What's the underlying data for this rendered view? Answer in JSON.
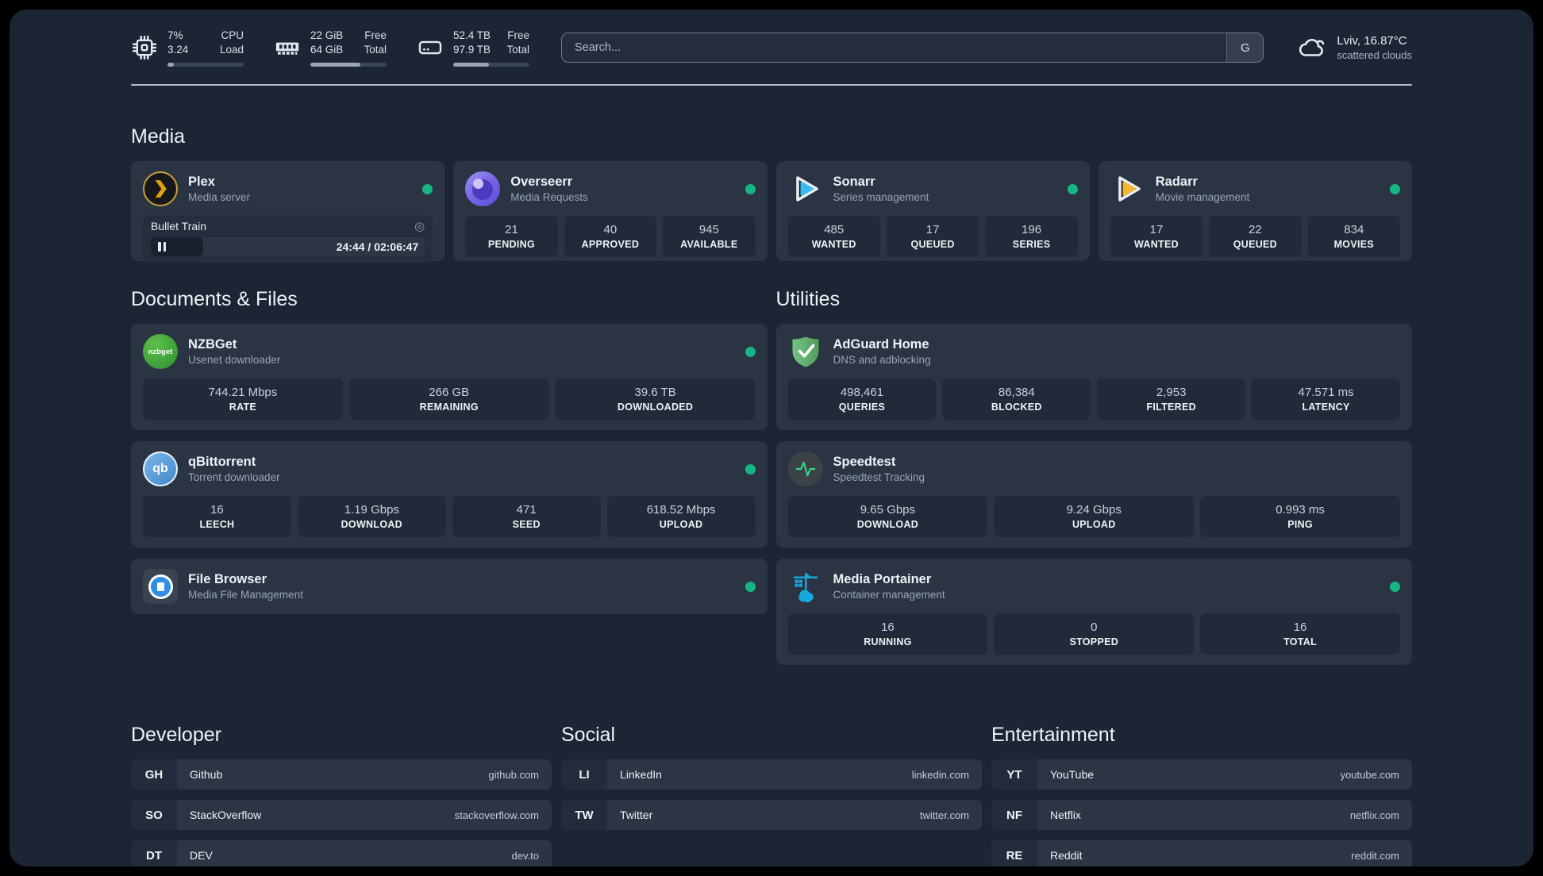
{
  "header": {
    "stats": [
      {
        "icon": "cpu-icon",
        "values": [
          "7%",
          "3.24"
        ],
        "labels": [
          "CPU",
          "Load"
        ],
        "progress_pct": 8
      },
      {
        "icon": "memory-icon",
        "values": [
          "22 GiB",
          "64 GiB"
        ],
        "labels": [
          "Free",
          "Total"
        ],
        "progress_pct": 66
      },
      {
        "icon": "disk-icon",
        "values": [
          "52.4 TB",
          "97.9 TB"
        ],
        "labels": [
          "Free",
          "Total"
        ],
        "progress_pct": 47
      }
    ],
    "search": {
      "placeholder": "Search...",
      "engine_label": "G"
    },
    "weather": {
      "icon": "cloud-icon",
      "title": "Lviv, 16.87°C",
      "subtitle": "scattered clouds"
    }
  },
  "media": {
    "heading": "Media",
    "plex": {
      "name": "Plex",
      "desc": "Media server",
      "status": "online",
      "now_playing": {
        "title": "Bullet Train",
        "time": "24:44 / 02:06:47",
        "progress_pct": 19,
        "cast_glyph": "◎"
      }
    },
    "overseerr": {
      "name": "Overseerr",
      "desc": "Media Requests",
      "status": "online",
      "stats": [
        {
          "value": "21",
          "label": "PENDING"
        },
        {
          "value": "40",
          "label": "APPROVED"
        },
        {
          "value": "945",
          "label": "AVAILABLE"
        }
      ]
    },
    "sonarr": {
      "name": "Sonarr",
      "desc": "Series management",
      "status": "online",
      "stats": [
        {
          "value": "485",
          "label": "WANTED"
        },
        {
          "value": "17",
          "label": "QUEUED"
        },
        {
          "value": "196",
          "label": "SERIES"
        }
      ]
    },
    "radarr": {
      "name": "Radarr",
      "desc": "Movie management",
      "status": "online",
      "stats": [
        {
          "value": "17",
          "label": "WANTED"
        },
        {
          "value": "22",
          "label": "QUEUED"
        },
        {
          "value": "834",
          "label": "MOVIES"
        }
      ]
    }
  },
  "documents": {
    "heading": "Documents & Files",
    "nzbget": {
      "name": "NZBGet",
      "desc": "Usenet downloader",
      "icon_text": "nzbget",
      "status": "online",
      "stats": [
        {
          "value": "744.21 Mbps",
          "label": "RATE"
        },
        {
          "value": "266 GB",
          "label": "REMAINING"
        },
        {
          "value": "39.6 TB",
          "label": "DOWNLOADED"
        }
      ]
    },
    "qbittorrent": {
      "name": "qBittorrent",
      "desc": "Torrent downloader",
      "icon_text": "qb",
      "status": "online",
      "stats": [
        {
          "value": "16",
          "label": "LEECH"
        },
        {
          "value": "1.19 Gbps",
          "label": "DOWNLOAD"
        },
        {
          "value": "471",
          "label": "SEED"
        },
        {
          "value": "618.52 Mbps",
          "label": "UPLOAD"
        }
      ]
    },
    "filebrowser": {
      "name": "File Browser",
      "desc": "Media File Management",
      "status": "online"
    }
  },
  "utilities": {
    "heading": "Utilities",
    "adguard": {
      "name": "AdGuard Home",
      "desc": "DNS and adblocking",
      "stats": [
        {
          "value": "498,461",
          "label": "QUERIES"
        },
        {
          "value": "86,384",
          "label": "BLOCKED"
        },
        {
          "value": "2,953",
          "label": "FILTERED"
        },
        {
          "value": "47.571 ms",
          "label": "LATENCY"
        }
      ]
    },
    "speedtest": {
      "name": "Speedtest",
      "desc": "Speedtest Tracking",
      "stats": [
        {
          "value": "9.65 Gbps",
          "label": "DOWNLOAD"
        },
        {
          "value": "9.24 Gbps",
          "label": "UPLOAD"
        },
        {
          "value": "0.993 ms",
          "label": "PING"
        }
      ]
    },
    "portainer": {
      "name": "Media Portainer",
      "desc": "Container management",
      "status": "online",
      "stats": [
        {
          "value": "16",
          "label": "RUNNING"
        },
        {
          "value": "0",
          "label": "STOPPED"
        },
        {
          "value": "16",
          "label": "TOTAL"
        }
      ]
    }
  },
  "bookmarks": {
    "developer": {
      "heading": "Developer",
      "items": [
        {
          "abbr": "GH",
          "name": "Github",
          "url": "github.com"
        },
        {
          "abbr": "SO",
          "name": "StackOverflow",
          "url": "stackoverflow.com"
        },
        {
          "abbr": "DT",
          "name": "DEV",
          "url": "dev.to"
        }
      ]
    },
    "social": {
      "heading": "Social",
      "items": [
        {
          "abbr": "LI",
          "name": "LinkedIn",
          "url": "linkedin.com"
        },
        {
          "abbr": "TW",
          "name": "Twitter",
          "url": "twitter.com"
        }
      ]
    },
    "entertainment": {
      "heading": "Entertainment",
      "items": [
        {
          "abbr": "YT",
          "name": "YouTube",
          "url": "youtube.com"
        },
        {
          "abbr": "NF",
          "name": "Netflix",
          "url": "netflix.com"
        },
        {
          "abbr": "RE",
          "name": "Reddit",
          "url": "reddit.com"
        }
      ]
    }
  },
  "colors": {
    "accent_green": "#17b583",
    "page_bg": "#1c2533",
    "card_bg": "#2a3442"
  }
}
